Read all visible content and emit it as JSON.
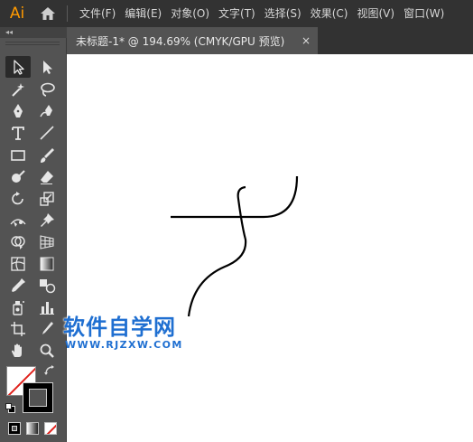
{
  "app": {
    "logo": "Ai"
  },
  "menu": [
    "文件(F)",
    "编辑(E)",
    "对象(O)",
    "文字(T)",
    "选择(S)",
    "效果(C)",
    "视图(V)",
    "窗口(W)"
  ],
  "document_tab": {
    "title": "未标题-1* @ 194.69% (CMYK/GPU 预览)",
    "close": "×"
  },
  "panel": {
    "collapse": "◂◂"
  },
  "watermark": {
    "text_cn": "软件自学网",
    "url": "WWW.RJZXW.COM"
  },
  "colors": {
    "accent": "#FF9A00",
    "watermark": "#1f6fd1",
    "fill": "#ffffff",
    "stroke": "#000000"
  },
  "tools": [
    "selection-tool",
    "direct-selection-tool",
    "magic-wand-tool",
    "lasso-tool",
    "pen-tool",
    "curvature-tool",
    "type-tool",
    "line-segment-tool",
    "rectangle-tool",
    "paintbrush-tool",
    "shaper-tool",
    "eraser-tool",
    "rotate-tool",
    "scale-tool",
    "width-tool",
    "puppet-warp-tool",
    "shape-builder-tool",
    "perspective-grid-tool",
    "mesh-tool",
    "gradient-tool",
    "eyedropper-tool",
    "blend-tool",
    "symbol-sprayer-tool",
    "column-graph-tool",
    "artboard-tool",
    "slice-tool",
    "hand-tool",
    "zoom-tool"
  ]
}
